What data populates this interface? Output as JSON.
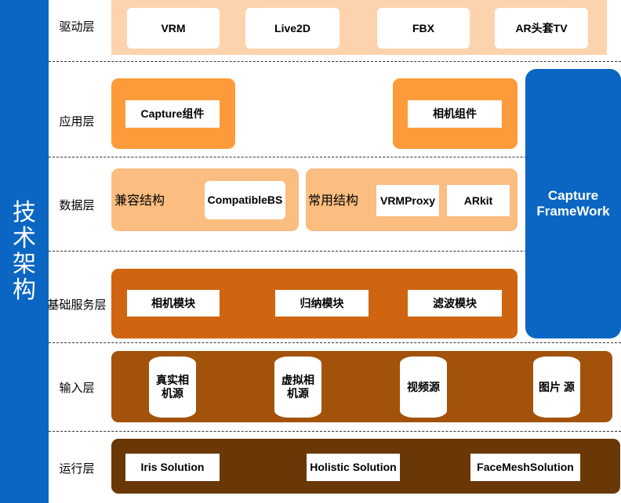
{
  "title": "技术架构",
  "layers": {
    "driver": {
      "label": "驱动层",
      "items": [
        "VRM",
        "Live2D",
        "FBX",
        "AR头套TV"
      ]
    },
    "application": {
      "label": "应用层",
      "items": [
        "Capture组件",
        "相机组件"
      ]
    },
    "data": {
      "label": "数据层",
      "compat_group": {
        "label": "兼容结构",
        "items": [
          "CompatibleBS"
        ]
      },
      "common_group": {
        "label": "常用结构",
        "items": [
          "VRMProxy",
          "ARkit"
        ]
      }
    },
    "base_service": {
      "label": "基础服务层",
      "items": [
        "相机模块",
        "归纳模块",
        "滤波模块"
      ]
    },
    "input": {
      "label": "输入层",
      "items": [
        "真实相机源",
        "虚拟相机源",
        "视频源",
        "图片 源"
      ]
    },
    "runtime": {
      "label": "运行层",
      "items": [
        "Iris Solution",
        "Holistic Solution",
        "FaceMeshSolution"
      ]
    }
  },
  "framework": {
    "line1": "Capture",
    "line2": "FrameWork"
  },
  "colors": {
    "blue": "#0a66c2",
    "driver_band": "#fdd3ad",
    "application": "#fd9b3a",
    "data": "#fbbd80",
    "base_service": "#cf6510",
    "input": "#a3520b",
    "runtime": "#6a3807"
  }
}
